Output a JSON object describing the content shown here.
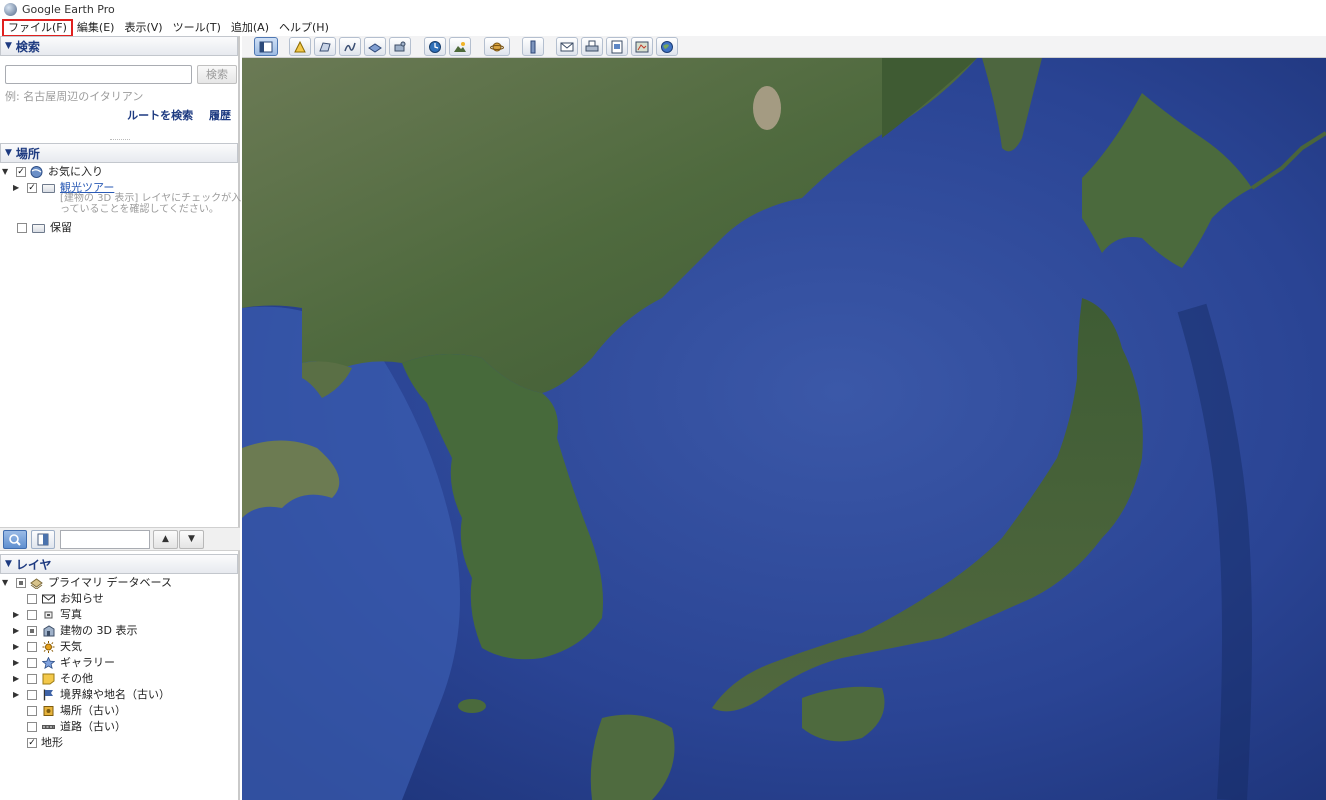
{
  "window": {
    "title": "Google Earth Pro"
  },
  "menu": [
    {
      "label": "ファイル(F)",
      "highlighted": true
    },
    {
      "label": "編集(E)"
    },
    {
      "label": "表示(V)"
    },
    {
      "label": "ツール(T)"
    },
    {
      "label": "追加(A)"
    },
    {
      "label": "ヘルプ(H)"
    }
  ],
  "search": {
    "header": "検索",
    "input_placeholder": "",
    "button_label": "検索",
    "hint": "例: 名古屋周辺のイタリアン",
    "route_link": "ルートを検索",
    "history_link": "履歴"
  },
  "places": {
    "header": "場所",
    "favorites": "お気に入り",
    "tour": "観光ツアー",
    "tour_note": "[建物の 3D 表示] レイヤにチェックが入っていることを確認してください。",
    "temporary": "保留"
  },
  "layers": {
    "header": "レイヤ",
    "root": "プライマリ データベース",
    "items": [
      {
        "label": "お知らせ",
        "icon": "mail-icon"
      },
      {
        "label": "写真",
        "icon": "photo-icon"
      },
      {
        "label": "建物の 3D 表示",
        "icon": "building-3d-icon"
      },
      {
        "label": "天気",
        "icon": "sun-icon"
      },
      {
        "label": "ギャラリー",
        "icon": "star-icon"
      },
      {
        "label": "その他",
        "icon": "note-icon"
      },
      {
        "label": "境界線や地名（古い）",
        "icon": "flag-icon"
      },
      {
        "label": "場所（古い）",
        "icon": "place-icon"
      },
      {
        "label": "道路（古い）",
        "icon": "road-icon"
      },
      {
        "label": "地形",
        "icon": "terrain-icon"
      }
    ]
  },
  "toolbar_icons": [
    "sidebar-toggle-icon",
    "placemark-icon",
    "polygon-icon",
    "path-icon",
    "image-overlay-icon",
    "record-tour-icon",
    "historical-imagery-icon",
    "sunlight-icon",
    "planets-icon",
    "ruler-icon",
    "email-icon",
    "print-icon",
    "save-image-icon",
    "view-in-maps-icon",
    "earth-gallery-icon"
  ],
  "colors": {
    "menu_highlight": "#e0201f",
    "panel_header_text": "#1d3a80",
    "link": "#2a5ab5"
  }
}
